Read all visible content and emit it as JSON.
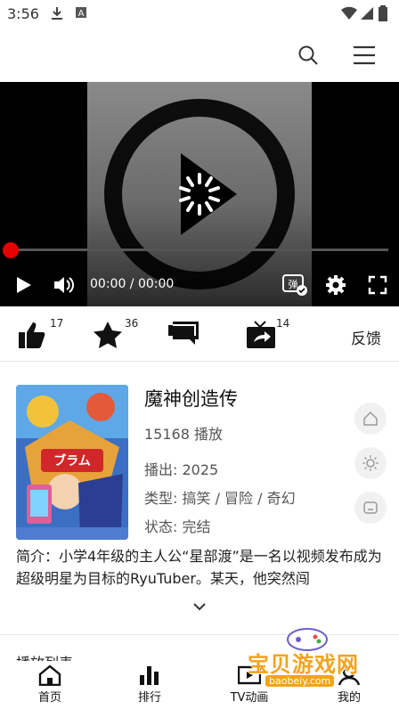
{
  "status_bar": {
    "time": "3:56"
  },
  "player": {
    "current_time": "00:00",
    "separator": " / ",
    "duration": "00:00",
    "progress": 0
  },
  "actions": {
    "like_count": "17",
    "favorite_count": "36",
    "share_count": "14",
    "feedback_label": "反馈"
  },
  "info": {
    "title": "魔神创造传",
    "plays": "15168 播放",
    "air": "播出: 2025",
    "genre": "类型: 搞笑 / 冒险 / 奇幻",
    "state": "状态: 完结",
    "intro": "简介：小学4年级的主人公“星部渡”是一名以视频发布成为超级明星为目标的RyuTuber。某天，他突然闯"
  },
  "section": {
    "title": "播放列表"
  },
  "tabs": [
    {
      "label": "首页"
    },
    {
      "label": "排行"
    },
    {
      "label": "TV动画"
    },
    {
      "label": "我的"
    }
  ],
  "watermark": {
    "text": "宝贝游戏网",
    "url": "baobeiy.com"
  },
  "colors": {
    "accent": "#e60000",
    "watermark": "#f4a31b"
  }
}
